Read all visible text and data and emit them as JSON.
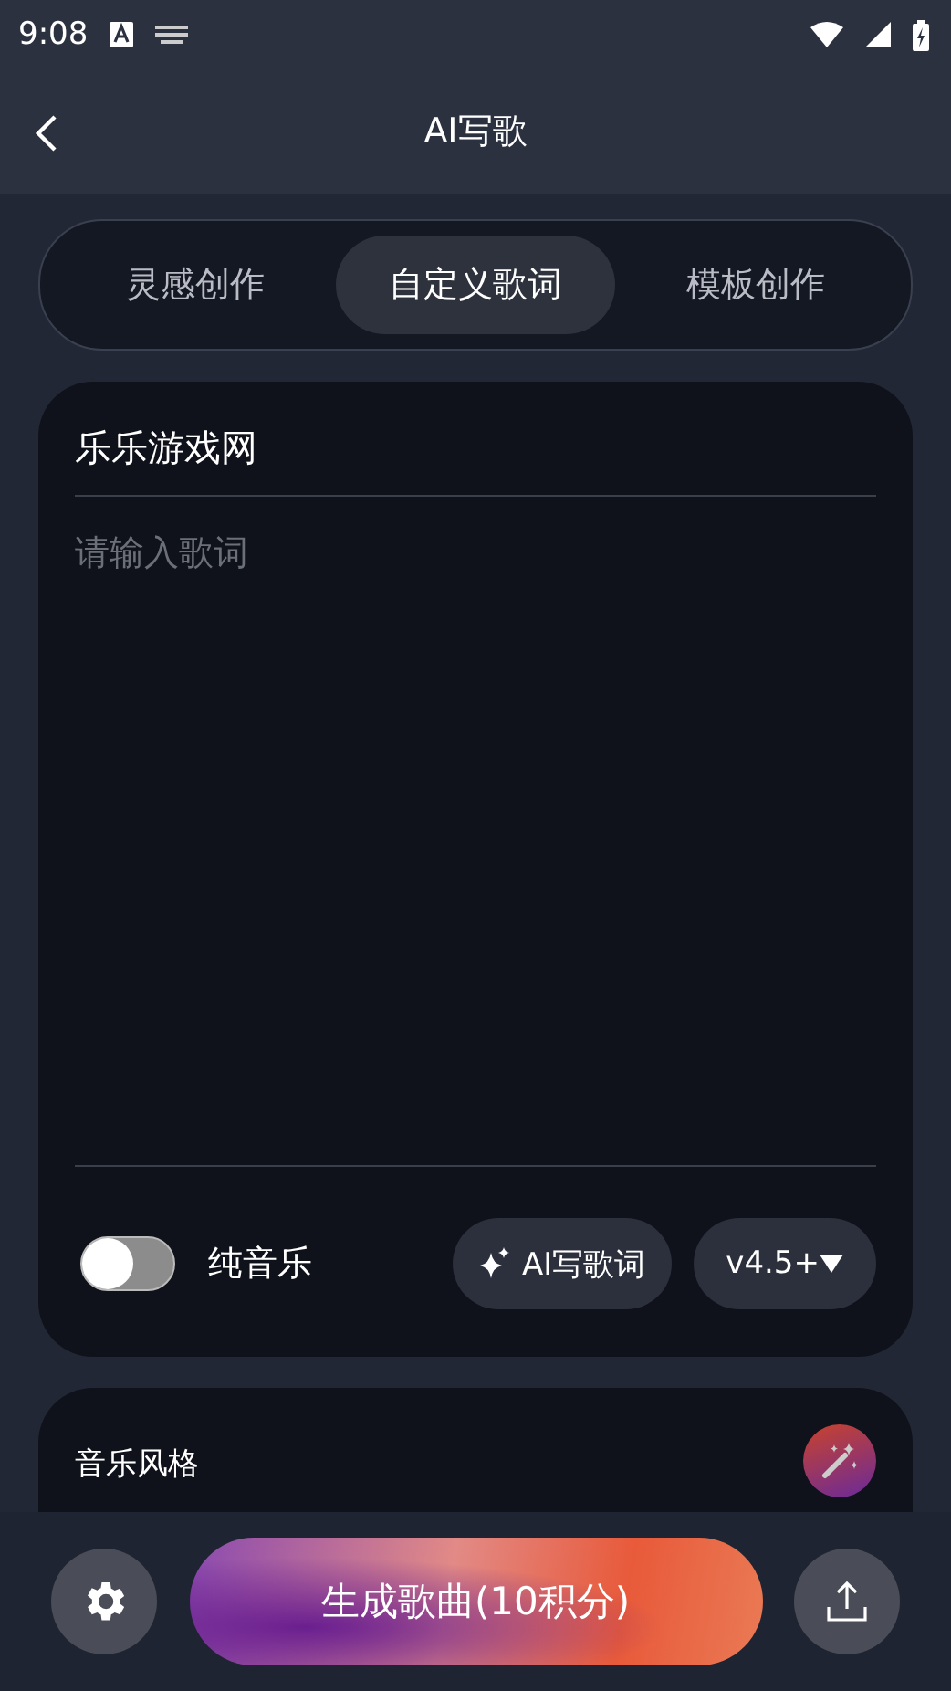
{
  "status_bar": {
    "time": "9:08"
  },
  "header": {
    "title": "AI写歌"
  },
  "tabs": [
    {
      "label": "灵感创作",
      "selected": false
    },
    {
      "label": "自定义歌词",
      "selected": true
    },
    {
      "label": "模板创作",
      "selected": false
    }
  ],
  "song_title": {
    "value": "乐乐游戏网"
  },
  "lyrics": {
    "placeholder": "请输入歌词"
  },
  "instrumental": {
    "label": "纯音乐",
    "on": false
  },
  "ai_lyrics_button": "AI写歌词",
  "version_button": "v4.5+",
  "style_section": {
    "title": "音乐风格"
  },
  "generate_button": "生成歌曲(10积分)"
}
